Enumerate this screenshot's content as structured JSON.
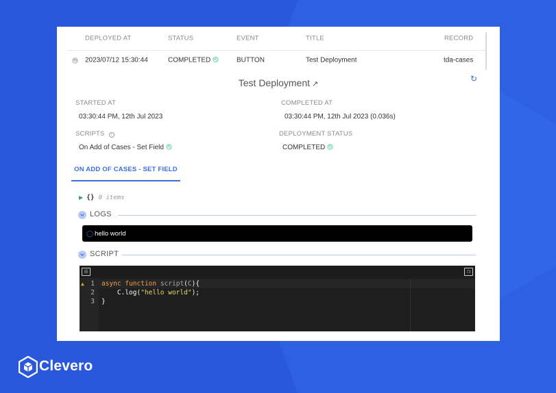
{
  "table": {
    "headers": [
      "DEPLOYED AT",
      "STATUS",
      "EVENT",
      "TITLE",
      "RECORD"
    ],
    "row": {
      "deployed_at": "2023/07/12 15:30:44",
      "status": "COMPLETED",
      "event": "BUTTON",
      "title": "Test Deployment",
      "record": "tda-cases"
    }
  },
  "detail": {
    "title": "Test Deployment",
    "started_at_label": "STARTED AT",
    "started_at": "03:30:44 PM, 12th Jul 2023",
    "completed_at_label": "COMPLETED AT",
    "completed_at": "03:30:44 PM, 12th Jul 2023 (0.036s)",
    "scripts_label": "SCRIPTS",
    "script_name": "On Add of Cases - Set Field",
    "deployment_status_label": "DEPLOYMENT STATUS",
    "deployment_status": "COMPLETED"
  },
  "tabs": [
    {
      "label": "ON ADD OF CASES - SET FIELD",
      "active": true
    }
  ],
  "json_viewer": {
    "brace": "{}",
    "count": "0 items"
  },
  "logs": {
    "label": "LOGS",
    "output": "hello world"
  },
  "script": {
    "label": "SCRIPT",
    "line_numbers": [
      "1",
      "2",
      "3"
    ]
  },
  "brand": {
    "name": "Clevero"
  },
  "colors": {
    "accent": "#3b6fe0",
    "success": "#a9e4c9",
    "background": "#2a58da"
  }
}
